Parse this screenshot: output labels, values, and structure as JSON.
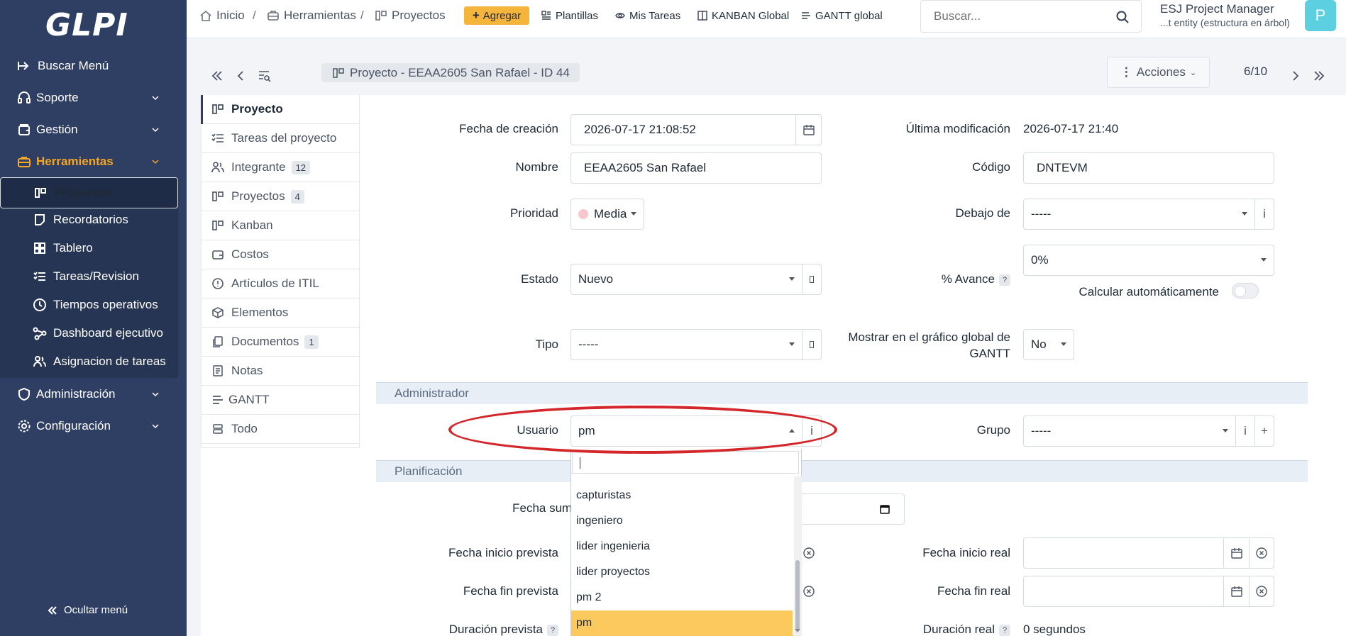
{
  "app": {
    "logo": "GLPI"
  },
  "sidebar": {
    "items": [
      {
        "label": "Buscar Menú"
      },
      {
        "label": "Soporte"
      },
      {
        "label": "Gestión"
      },
      {
        "label": "Herramientas"
      },
      {
        "label": "Administración"
      },
      {
        "label": "Configuración"
      }
    ],
    "sub_items": [
      {
        "label": "Proyectos"
      },
      {
        "label": "Recordatorios"
      },
      {
        "label": "Tablero"
      },
      {
        "label": "Tareas/Revision"
      },
      {
        "label": "Tiempos operativos"
      },
      {
        "label": "Dashboard ejecutivo"
      },
      {
        "label": "Asignacion de tareas"
      }
    ],
    "collapse_label": "Ocultar menú",
    "accent_color": "#f5a623"
  },
  "topbar": {
    "breadcrumb": [
      "Inicio",
      "Herramientas",
      "Proyectos"
    ],
    "add_label": "Agregar",
    "links": [
      "Plantillas",
      "Mis Tareas",
      "KANBAN Global",
      "GANTT global"
    ],
    "search_placeholder": "Buscar...",
    "user_name": "ESJ Project Manager",
    "user_entity": "...t entity (estructura en árbol)",
    "avatar_letter": "P"
  },
  "record": {
    "title": "Proyecto -  EEAA2605 San Rafael - ID 44",
    "actions_label": "Acciones",
    "pager": "6/10"
  },
  "tabs": [
    {
      "label": "Proyecto"
    },
    {
      "label": "Tareas del proyecto"
    },
    {
      "label": "Integrante",
      "badge": "12"
    },
    {
      "label": "Proyectos",
      "badge": "4"
    },
    {
      "label": "Kanban"
    },
    {
      "label": "Costos"
    },
    {
      "label": "Artículos de ITIL"
    },
    {
      "label": "Elementos"
    },
    {
      "label": "Documentos",
      "badge": "1"
    },
    {
      "label": "Notas"
    },
    {
      "label": "GANTT"
    },
    {
      "label": "Todo"
    }
  ],
  "form": {
    "creation_label": "Fecha de creación",
    "creation_value": "2026-07-17 21:08:52",
    "modified_label": "Última modificación",
    "modified_value": "2026-07-17 21:40",
    "name_label": "Nombre",
    "name_value": "EEAA2605 San Rafael",
    "code_label": "Código",
    "code_value": "DNTEVM",
    "priority_label": "Prioridad",
    "priority_value": "Media",
    "parent_label": "Debajo de",
    "parent_value": "-----",
    "progress_label": "% Avance",
    "progress_value": "0%",
    "auto_calc_label": "Calcular automáticamente",
    "state_label": "Estado",
    "state_value": "Nuevo",
    "type_label": "Tipo",
    "type_value": "-----",
    "gantt_label_1": "Mostrar en el gráfico global de",
    "gantt_label_2": "GANTT",
    "gantt_value": "No",
    "admin_section": "Administrador",
    "user_label": "Usuario",
    "user_value": "pm",
    "group_label": "Grupo",
    "group_value": "-----",
    "planning_section": "Planificación",
    "supply_label": "Fecha sumi",
    "plan_start_label": "Fecha inicio prevista",
    "plan_end_label": "Fecha fin prevista",
    "real_start_label": "Fecha inicio real",
    "real_end_label": "Fecha fin real",
    "plan_duration_label": "Duración prevista",
    "real_duration_label": "Duración real",
    "real_duration_value": "0 segundos",
    "help_mark": "?"
  },
  "dropdown": {
    "options": [
      "capturistas",
      "ingeniero",
      "lider ingenieria",
      "lider proyectos",
      "pm 2",
      "pm"
    ],
    "selected": "pm",
    "highlight_color": "#fbc95d"
  },
  "annotation": {
    "color": "#d3272c"
  }
}
